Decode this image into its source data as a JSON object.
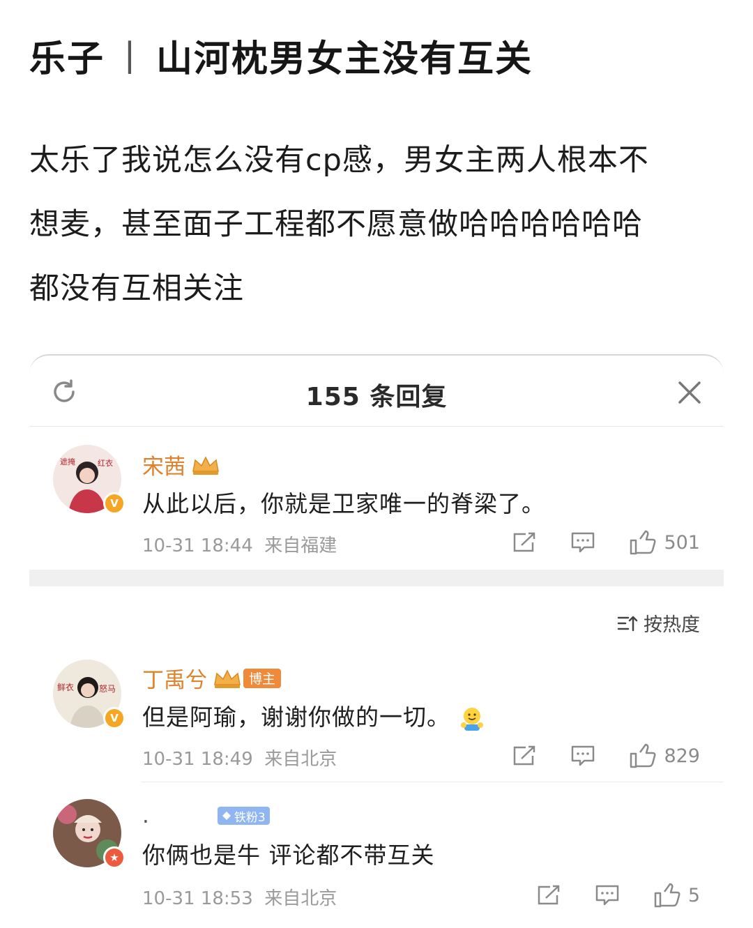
{
  "post": {
    "title_left": "乐子",
    "title_sep": "丨",
    "title_right": "山河枕男女主没有互关",
    "body_line1": "太乐了我说怎么没有cp感，男女主两人根本不",
    "body_line2": "想麦，甚至面子工程都不愿意做哈哈哈哈哈哈",
    "body_line3": "都没有互相关注"
  },
  "panel": {
    "title": "155 条回复",
    "sort_label": "按热度"
  },
  "comments": [
    {
      "user": "宋茜",
      "badge": "V",
      "text": "从此以后，你就是卫家唯一的脊梁了。",
      "time": "10-31 18:44",
      "location": "来自福建",
      "likes": "501"
    },
    {
      "user": "丁禹兮",
      "badge": "V",
      "tag": "博主",
      "text": "但是阿瑜，谢谢你做的一切。",
      "emoji": "hugging-emoji",
      "time": "10-31 18:49",
      "location": "来自北京",
      "likes": "829"
    },
    {
      "user": ".",
      "tag": "铁粉3",
      "text": "你俩也是牛 评论都不带互关",
      "time": "10-31 18:53",
      "location": "来自北京",
      "likes": "5"
    }
  ],
  "colors": {
    "username": "#e0822b",
    "meta": "#9a9a9a",
    "gold_badge": "#f5a623",
    "red_badge": "#ec5b3e",
    "fan_tag": "#8fb6f0",
    "blogger_tag": "#f08a3b"
  }
}
